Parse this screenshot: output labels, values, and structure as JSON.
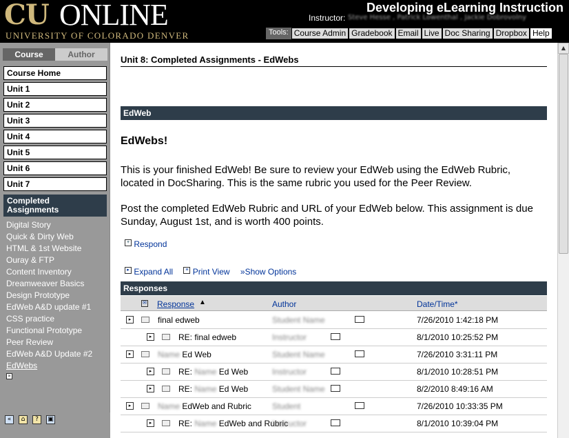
{
  "header": {
    "logo_cu": "CU",
    "logo_online": "ONLINE",
    "logo_subtitle": "UNIVERSITY OF COLORADO DENVER",
    "course_title": "Developing eLearning Instruction",
    "instructor_label": "Instructor:",
    "instructor_names": "Steve Hesse , Patrick Lowenthal , Jackie Dobrovolny",
    "tools_label": "Tools:",
    "tools": [
      "Course Admin",
      "Gradebook",
      "Email",
      "Live",
      "Doc Sharing",
      "Dropbox",
      "Help"
    ]
  },
  "nav": {
    "tabs": [
      "Course",
      "Author"
    ],
    "units": [
      "Course Home",
      "Unit 1",
      "Unit 2",
      "Unit 3",
      "Unit 4",
      "Unit 5",
      "Unit 6",
      "Unit 7"
    ],
    "current_unit": "Completed Assignments",
    "sub_items": [
      "Digital Story",
      "Quick & Dirty Web",
      "HTML & 1st Website",
      "Ouray & FTP",
      "Content Inventory",
      "Dreamweaver Basics",
      "Design Prototype",
      "EdWeb A&D update #1",
      "CSS practice",
      "Functional Prototype",
      "Peer Review",
      "EdWeb A&D Update #2",
      "EdWebs"
    ]
  },
  "main": {
    "page_title": "Unit 8: Completed Assignments - EdWebs",
    "section_label": "EdWeb",
    "heading": "EdWebs!",
    "paragraph1": "This is your finished EdWeb!  Be sure to review your EdWeb using the EdWeb Rubric, located in DocSharing.  This is the same rubric you used for the Peer Review.",
    "paragraph2": "Post the completed EdWeb Rubric and URL of your EdWeb below.  This assignment is due Sunday, August 1st, and is worth 400 points.",
    "respond_label": "Respond",
    "expand_all": "Expand All",
    "print_view": "Print View",
    "show_options": "»Show Options",
    "responses_label": "Responses",
    "columns": {
      "response": "Response",
      "author": "Author",
      "date": "Date/Time*"
    },
    "rows": [
      {
        "level": 0,
        "prefix": "",
        "blur": "",
        "subject": "final edweb",
        "author": "Student Name",
        "date": "7/26/2010 1:42:18 PM"
      },
      {
        "level": 1,
        "prefix": "RE:",
        "blur": "",
        "subject": "final edweb",
        "author": "Instructor",
        "date": "8/1/2010 10:25:52 PM"
      },
      {
        "level": 0,
        "prefix": "",
        "blur": "Name",
        "subject": "Ed Web",
        "author": "Student Name",
        "date": "7/26/2010 3:31:11 PM"
      },
      {
        "level": 1,
        "prefix": "RE:",
        "blur": "Name",
        "subject": "Ed Web",
        "author": "Instructor",
        "date": "8/1/2010 10:28:51 PM"
      },
      {
        "level": 1,
        "prefix": "RE:",
        "blur": "Name",
        "subject": "Ed Web",
        "author": "Student Name",
        "date": "8/2/2010 8:49:16 AM"
      },
      {
        "level": 0,
        "prefix": "",
        "blur": "Name",
        "subject": "EdWeb and Rubric",
        "author": "Student",
        "date": "7/26/2010 10:33:35 PM"
      },
      {
        "level": 1,
        "prefix": "RE:",
        "blur": "Name",
        "subject": "EdWeb and Rubric",
        "author": "Instructor",
        "date": "8/1/2010 10:39:04 PM"
      }
    ]
  }
}
